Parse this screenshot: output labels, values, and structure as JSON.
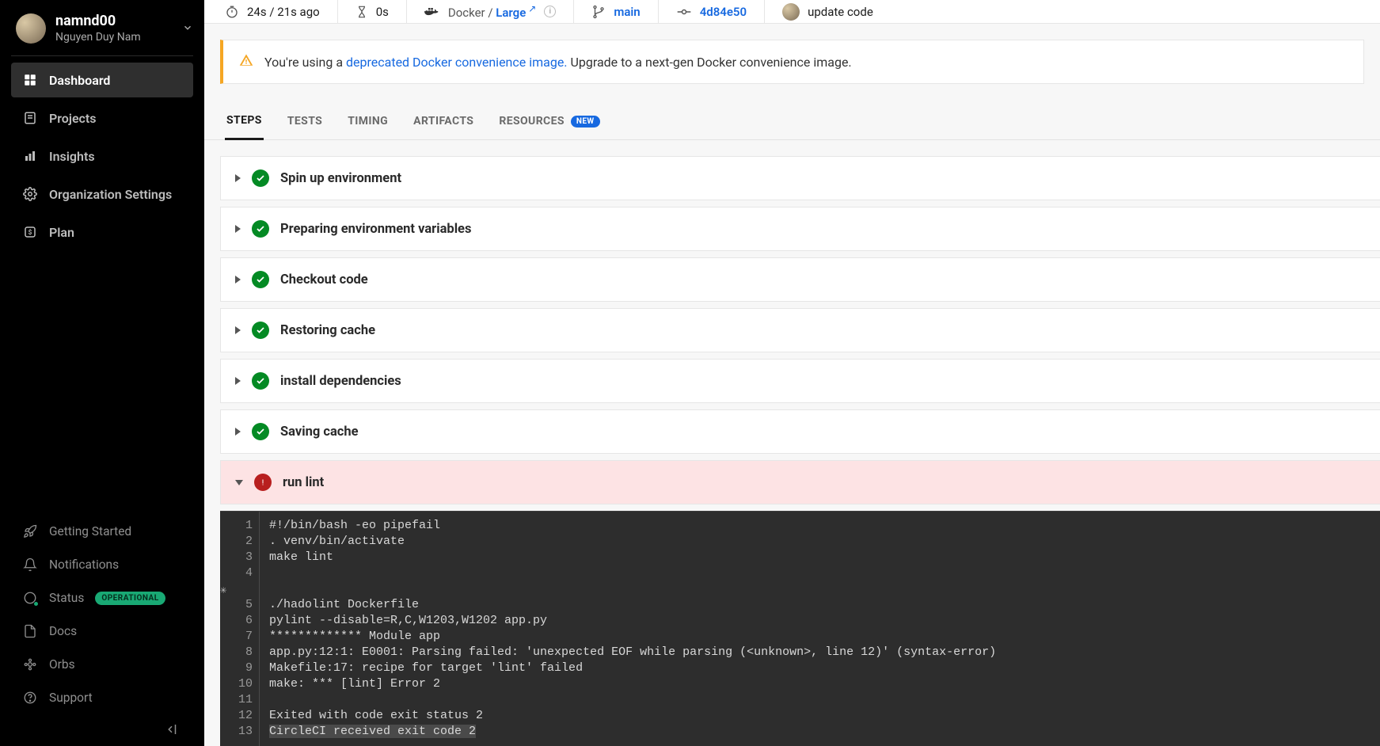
{
  "user": {
    "name": "namnd00",
    "sub": "Nguyen Duy Nam"
  },
  "nav": {
    "dashboard": "Dashboard",
    "projects": "Projects",
    "insights": "Insights",
    "org_settings": "Organization Settings",
    "plan": "Plan"
  },
  "bottom": {
    "getting_started": "Getting Started",
    "notifications": "Notifications",
    "status_label": "Status",
    "status_badge": "OPERATIONAL",
    "docs": "Docs",
    "orbs": "Orbs",
    "support": "Support"
  },
  "meta": {
    "duration": "24s / 21s ago",
    "queued": "0s",
    "executor_prefix": "Docker / ",
    "executor_size": "Large",
    "branch": "main",
    "commit": "4d84e50",
    "message": "update code"
  },
  "banner": {
    "prefix": "You're using a ",
    "link": "deprecated Docker convenience image.",
    "suffix": " Upgrade to a next-gen Docker convenience image."
  },
  "tabs": {
    "steps": "STEPS",
    "tests": "TESTS",
    "timing": "TIMING",
    "artifacts": "ARTIFACTS",
    "resources": "RESOURCES",
    "new_badge": "NEW"
  },
  "steps": [
    {
      "name": "Spin up environment",
      "status": "ok",
      "open": false
    },
    {
      "name": "Preparing environment variables",
      "status": "ok",
      "open": false
    },
    {
      "name": "Checkout code",
      "status": "ok",
      "open": false
    },
    {
      "name": "Restoring cache",
      "status": "ok",
      "open": false
    },
    {
      "name": "install dependencies",
      "status": "ok",
      "open": false
    },
    {
      "name": "Saving cache",
      "status": "ok",
      "open": false
    },
    {
      "name": "run lint",
      "status": "fail",
      "open": true
    }
  ],
  "console_lines": [
    "#!/bin/bash -eo pipefail",
    ". venv/bin/activate",
    "make lint",
    "",
    "./hadolint Dockerfile",
    "pylint --disable=R,C,W1203,W1202 app.py",
    "************* Module app",
    "app.py:12:1: E0001: Parsing failed: 'unexpected EOF while parsing (<unknown>, line 12)' (syntax-error)",
    "Makefile:17: recipe for target 'lint' failed",
    "make: *** [lint] Error 2",
    "",
    "Exited with code exit status 2",
    "CircleCI received exit code 2"
  ]
}
